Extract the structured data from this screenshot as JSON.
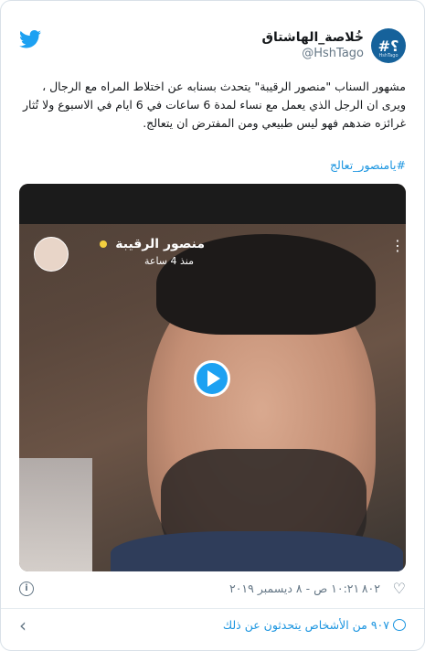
{
  "user": {
    "display_name": "خُلاصة_الهاشتاق",
    "handle": "@HshTago",
    "avatar_text": "#؟",
    "avatar_sub": "HshTago"
  },
  "tweet": {
    "text": "مشهور السناب \"منصور الرقيبة\" يتحدث بسنابه عن اختلاط المراه مع الرجال ، ويرى ان الرجل الذي يعمل مع نساء لمدة 6 ساعات في 6 ايام في الاسبوع ولا تُثار غرائزه ضدهم فهو ليس طبيعي ومن المفترض ان يتعالج.",
    "hashtag": "#يامنصور_تعالج"
  },
  "video": {
    "snap_name": "منصور الرقيبة",
    "snap_time": "منذ 4 ساعة"
  },
  "meta": {
    "datetime": "١٠:٢١ ص - ٨ ديسمبر ٢٠١٩",
    "likes": "٨٠٢",
    "info_glyph": "i"
  },
  "footer": {
    "talking": "٩٠٧ من الأشخاص يتحدثون عن ذلك"
  },
  "icons": {
    "bird": "twitter-bird-icon",
    "play": "play-icon",
    "heart": "heart-icon",
    "info": "info-icon",
    "chevron": "chevron-left-icon",
    "bubble": "speech-bubble-icon"
  },
  "colors": {
    "accent": "#1da1f2",
    "link": "#1b95e0",
    "muted": "#657786",
    "avatar_bg": "#16629b"
  }
}
